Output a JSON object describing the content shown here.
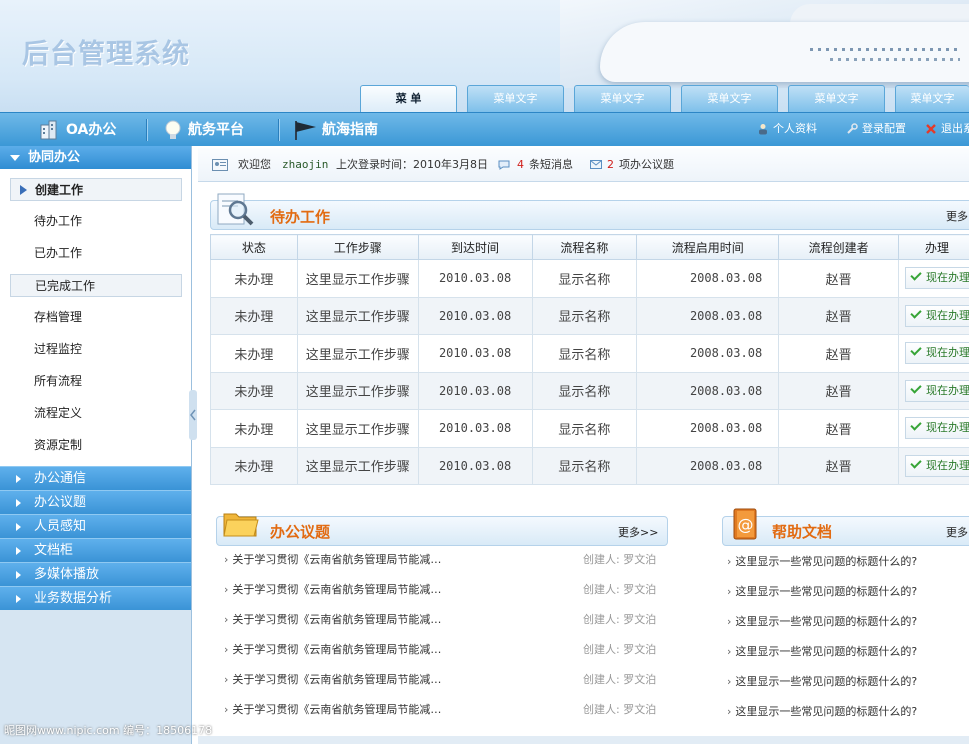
{
  "app": {
    "title": "后台管理系统"
  },
  "tabs": [
    {
      "label": "菜 单",
      "active": true
    },
    {
      "label": "菜单文字"
    },
    {
      "label": "菜单文字"
    },
    {
      "label": "菜单文字"
    },
    {
      "label": "菜单文字"
    },
    {
      "label": "菜单文字"
    }
  ],
  "nav": {
    "items": [
      {
        "label": "OA办公",
        "icon": "building-icon"
      },
      {
        "label": "航务平台",
        "icon": "lightbulb-icon"
      },
      {
        "label": "航海指南",
        "icon": "flag-icon"
      }
    ],
    "links": [
      {
        "label": "个人资料",
        "icon": "person-icon"
      },
      {
        "label": "登录配置",
        "icon": "wrench-icon"
      },
      {
        "label": "退出系",
        "icon": "close-icon"
      }
    ]
  },
  "sidebar": {
    "header": "协同办公",
    "items": [
      {
        "label": "创建工作"
      },
      {
        "label": "待办工作"
      },
      {
        "label": "已办工作"
      },
      {
        "label": "已完成工作"
      },
      {
        "label": "存档管理"
      },
      {
        "label": "过程监控"
      },
      {
        "label": "所有流程"
      },
      {
        "label": "流程定义"
      },
      {
        "label": "资源定制"
      }
    ],
    "groups": [
      {
        "label": "办公通信"
      },
      {
        "label": "办公议题"
      },
      {
        "label": "人员感知"
      },
      {
        "label": "文档柜"
      },
      {
        "label": "多媒体播放"
      },
      {
        "label": "业务数据分析"
      }
    ]
  },
  "welcome": {
    "greeting": "欢迎您",
    "user": "zhaojin",
    "last_login": "上次登录时间：2010年3月8日",
    "msg_count": "4",
    "msg_label": "条短消息",
    "topic_count": "2",
    "topic_label": "项办公议题"
  },
  "todo": {
    "title": "待办工作",
    "more": "更多",
    "columns": [
      "状态",
      "工作步骤",
      "到达时间",
      "流程名称",
      "流程启用时间",
      "流程创建者",
      "办理"
    ],
    "rows": [
      {
        "status": "未办理",
        "step": "这里显示工作步骤",
        "arrive": "2010.03.08",
        "flow": "显示名称",
        "start": "2008.03.08",
        "creator": "赵晋",
        "action": "现在办理"
      },
      {
        "status": "未办理",
        "step": "这里显示工作步骤",
        "arrive": "2010.03.08",
        "flow": "显示名称",
        "start": "2008.03.08",
        "creator": "赵晋",
        "action": "现在办理"
      },
      {
        "status": "未办理",
        "step": "这里显示工作步骤",
        "arrive": "2010.03.08",
        "flow": "显示名称",
        "start": "2008.03.08",
        "creator": "赵晋",
        "action": "现在办理"
      },
      {
        "status": "未办理",
        "step": "这里显示工作步骤",
        "arrive": "2010.03.08",
        "flow": "显示名称",
        "start": "2008.03.08",
        "creator": "赵晋",
        "action": "现在办理"
      },
      {
        "status": "未办理",
        "step": "这里显示工作步骤",
        "arrive": "2010.03.08",
        "flow": "显示名称",
        "start": "2008.03.08",
        "creator": "赵晋",
        "action": "现在办理"
      },
      {
        "status": "未办理",
        "step": "这里显示工作步骤",
        "arrive": "2010.03.08",
        "flow": "显示名称",
        "start": "2008.03.08",
        "creator": "赵晋",
        "action": "现在办理"
      }
    ]
  },
  "topics": {
    "title": "办公议题",
    "more": "更多>>",
    "items": [
      {
        "text": "关于学习贯彻《云南省航务管理局节能减…",
        "creator": "创建人: 罗文泊"
      },
      {
        "text": "关于学习贯彻《云南省航务管理局节能减…",
        "creator": "创建人: 罗文泊"
      },
      {
        "text": "关于学习贯彻《云南省航务管理局节能减…",
        "creator": "创建人: 罗文泊"
      },
      {
        "text": "关于学习贯彻《云南省航务管理局节能减…",
        "creator": "创建人: 罗文泊"
      },
      {
        "text": "关于学习贯彻《云南省航务管理局节能减…",
        "creator": "创建人: 罗文泊"
      },
      {
        "text": "关于学习贯彻《云南省航务管理局节能减…",
        "creator": "创建人: 罗文泊"
      }
    ]
  },
  "help": {
    "title": "帮助文档",
    "more": "更多",
    "items": [
      {
        "text": "这里显示一些常见问题的标题什么的?"
      },
      {
        "text": "这里显示一些常见问题的标题什么的?"
      },
      {
        "text": "这里显示一些常见问题的标题什么的?"
      },
      {
        "text": "这里显示一些常见问题的标题什么的?"
      },
      {
        "text": "这里显示一些常见问题的标题什么的?"
      },
      {
        "text": "这里显示一些常见问题的标题什么的?"
      }
    ]
  },
  "watermark": "昵图网www.nipic.com   编号：18506178",
  "colors": {
    "accent": "#3b98d6",
    "title_orange": "#e26b12",
    "msg_red": "#d0201c"
  }
}
